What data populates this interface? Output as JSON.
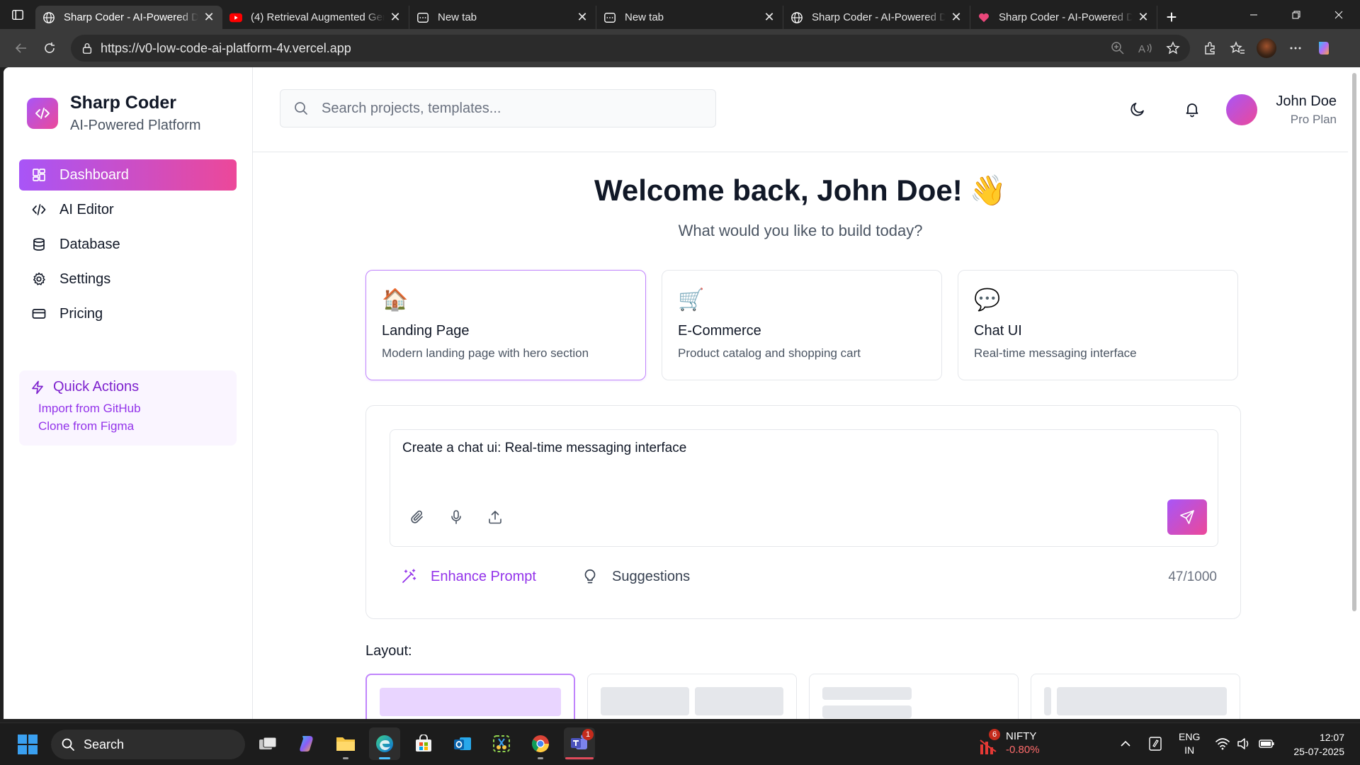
{
  "browser": {
    "tabs": [
      {
        "title": "Sharp Coder - AI-Powered Development",
        "favicon": "globe-icon",
        "active": true
      },
      {
        "title": "(4) Retrieval Augmented Generation",
        "favicon": "youtube-icon",
        "active": false
      },
      {
        "title": "New tab",
        "favicon": "new-tab-page-icon",
        "active": false
      },
      {
        "title": "New tab",
        "favicon": "new-tab-page-icon",
        "active": false
      },
      {
        "title": "Sharp Coder - AI-Powered Development",
        "favicon": "globe-icon",
        "active": false
      },
      {
        "title": "Sharp Coder - AI-Powered Development",
        "favicon": "heart-app-icon",
        "active": false
      }
    ],
    "url": "https://v0-low-code-ai-platform-4v.vercel.app"
  },
  "sidebar": {
    "brand_name": "Sharp Coder",
    "brand_subtitle": "AI-Powered Platform",
    "nav": [
      {
        "label": "Dashboard",
        "icon": "dashboard-icon",
        "active": true
      },
      {
        "label": "AI Editor",
        "icon": "code-icon",
        "active": false
      },
      {
        "label": "Database",
        "icon": "database-icon",
        "active": false
      },
      {
        "label": "Settings",
        "icon": "gear-icon",
        "active": false
      },
      {
        "label": "Pricing",
        "icon": "credit-card-icon",
        "active": false
      }
    ],
    "quick_actions": {
      "title": "Quick Actions",
      "links": [
        "Import from GitHub",
        "Clone from Figma"
      ]
    }
  },
  "header": {
    "search_placeholder": "Search projects, templates...",
    "user_name": "John Doe",
    "user_plan": "Pro Plan"
  },
  "main": {
    "welcome": "Welcome back, John Doe!",
    "welcome_emoji": "👋",
    "subtitle": "What would you like to build today?",
    "templates": [
      {
        "emoji": "🏠",
        "name": "Landing Page",
        "desc": "Modern landing page with hero section",
        "selected": true
      },
      {
        "emoji": "🛒",
        "name": "E-Commerce",
        "desc": "Product catalog and shopping cart",
        "selected": false
      },
      {
        "emoji": "💬",
        "name": "Chat UI",
        "desc": "Real-time messaging interface",
        "selected": false
      }
    ],
    "prompt_value": "Create a chat ui: Real-time messaging interface",
    "enhance_label": "Enhance Prompt",
    "suggestions_label": "Suggestions",
    "char_count": "47/1000",
    "layout_label": "Layout:"
  },
  "taskbar": {
    "search_label": "Search",
    "stock_name": "NIFTY",
    "stock_change": "-0.80%",
    "stock_badge": "6",
    "teams_badge": "1",
    "lang_line1": "ENG",
    "lang_line2": "IN",
    "time": "12:07",
    "date": "25-07-2025"
  },
  "colors": {
    "accent_start": "#a855f7",
    "accent_end": "#ec4899",
    "accent_text": "#9333ea"
  }
}
